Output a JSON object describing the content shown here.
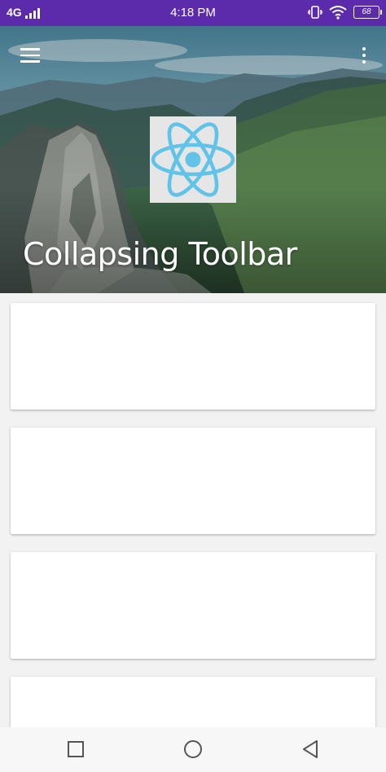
{
  "status_bar": {
    "network": "4G",
    "time": "4:18 PM",
    "battery": "68",
    "background": "#5b2bab"
  },
  "toolbar": {
    "title": "Collapsing Toolbar",
    "menu_icon": "hamburger-menu-icon",
    "overflow_icon": "more-vertical-icon",
    "logo_icon": "react-logo-icon",
    "logo_color": "#61c3e8"
  },
  "content": {
    "cards": [
      {
        "index": 1
      },
      {
        "index": 2
      },
      {
        "index": 3
      },
      {
        "index": 4
      }
    ]
  },
  "navigation_bar": {
    "buttons": [
      "recents-square-icon",
      "home-circle-icon",
      "back-triangle-icon"
    ]
  }
}
